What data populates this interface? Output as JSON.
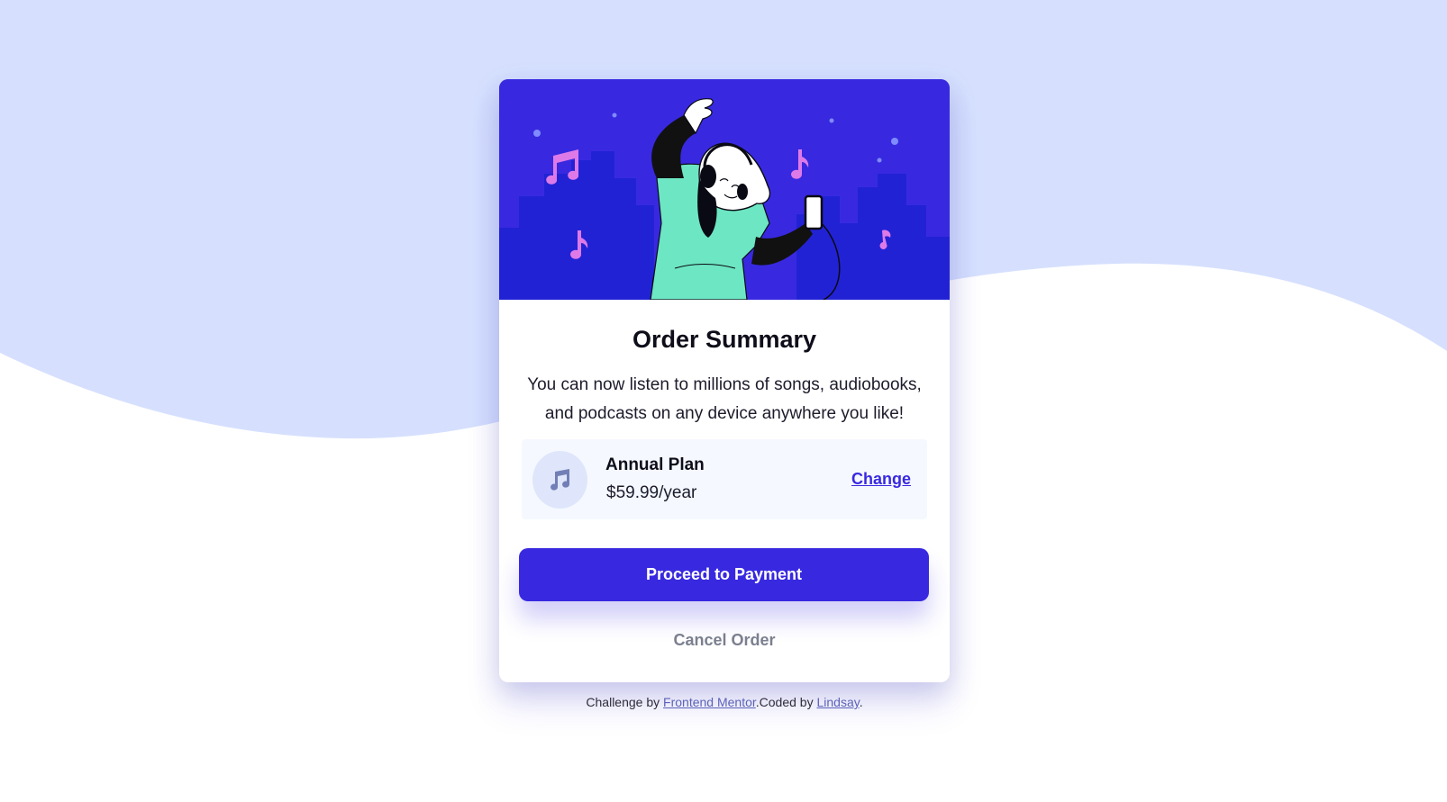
{
  "colors": {
    "page_bg": "#ffffff",
    "wave": "#d6e0fe",
    "brand": "#3829e0",
    "plan_bg": "#f5f8ff",
    "plan_icon_bg": "#dfe6fb",
    "cancel_text": "#7b7f8f"
  },
  "hero": {
    "icon": "dancing-person-with-headphones-illustration"
  },
  "card": {
    "title": "Order Summary",
    "description": "You can now listen to millions of songs, audiobooks, and podcasts on any device anywhere you like!",
    "plan": {
      "icon": "music-note-icon",
      "name": "Annual Plan",
      "price": "$59.99/year",
      "change_label": "Change"
    },
    "proceed_label": "Proceed to Payment",
    "cancel_label": "Cancel Order"
  },
  "attribution": {
    "prefix": "Challenge by ",
    "frontend_mentor": "Frontend Mentor",
    "middle": ".Coded by ",
    "author": "Lindsay",
    "suffix": "."
  }
}
